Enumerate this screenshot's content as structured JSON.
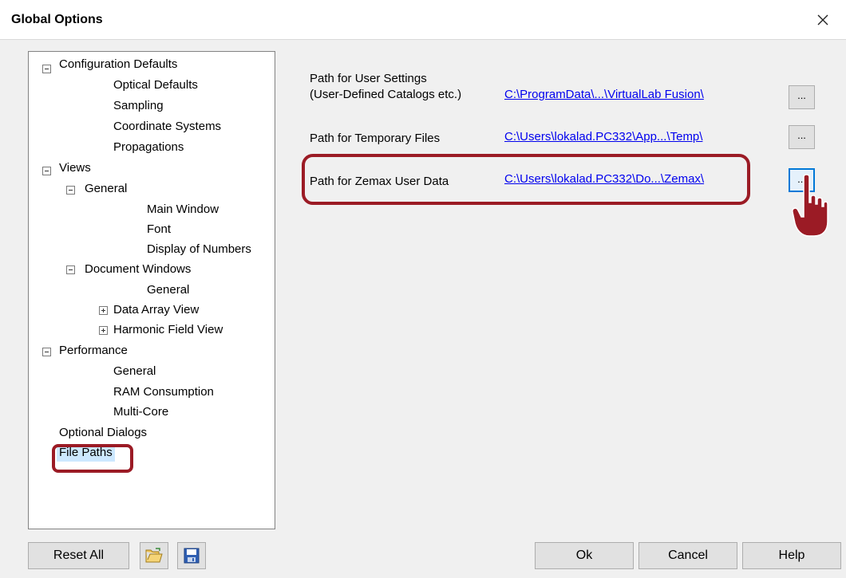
{
  "window": {
    "title": "Global Options"
  },
  "tree": {
    "configuration_defaults": "Configuration Defaults",
    "optical_defaults": "Optical Defaults",
    "sampling": "Sampling",
    "coordinate_systems": "Coordinate Systems",
    "propagations": "Propagations",
    "views": "Views",
    "views_general": "General",
    "main_window": "Main Window",
    "font": "Font",
    "display_of_numbers": "Display of Numbers",
    "document_windows": "Document Windows",
    "document_windows_general": "General",
    "data_array_view": "Data Array View",
    "harmonic_field_view": "Harmonic Field View",
    "performance": "Performance",
    "performance_general": "General",
    "ram_consumption": "RAM Consumption",
    "multi_core": "Multi-Core",
    "optional_dialogs": "Optional Dialogs",
    "file_paths": "File Paths"
  },
  "paths": {
    "user_settings_label_1": "Path for User Settings",
    "user_settings_label_2": "(User-Defined Catalogs etc.)",
    "user_settings_value": "C:\\ProgramData\\...\\VirtualLab Fusion\\",
    "temp_files_label": "Path for Temporary Files",
    "temp_files_value": "C:\\Users\\lokalad.PC332\\App...\\Temp\\",
    "zemax_label": "Path for Zemax User Data",
    "zemax_value": "C:\\Users\\lokalad.PC332\\Do...\\Zemax\\",
    "browse_label": "..."
  },
  "buttons": {
    "reset_all": "Reset All",
    "ok": "Ok",
    "cancel": "Cancel",
    "help": "Help"
  },
  "colors": {
    "highlight_box": "#9b1b25",
    "link": "#0000ee",
    "selection": "#cce8ff",
    "focus": "#0078d7"
  },
  "icons": {
    "close": "close-icon",
    "open_folder": "open-folder-icon",
    "save": "save-icon",
    "pointer": "pointing-hand-icon"
  }
}
